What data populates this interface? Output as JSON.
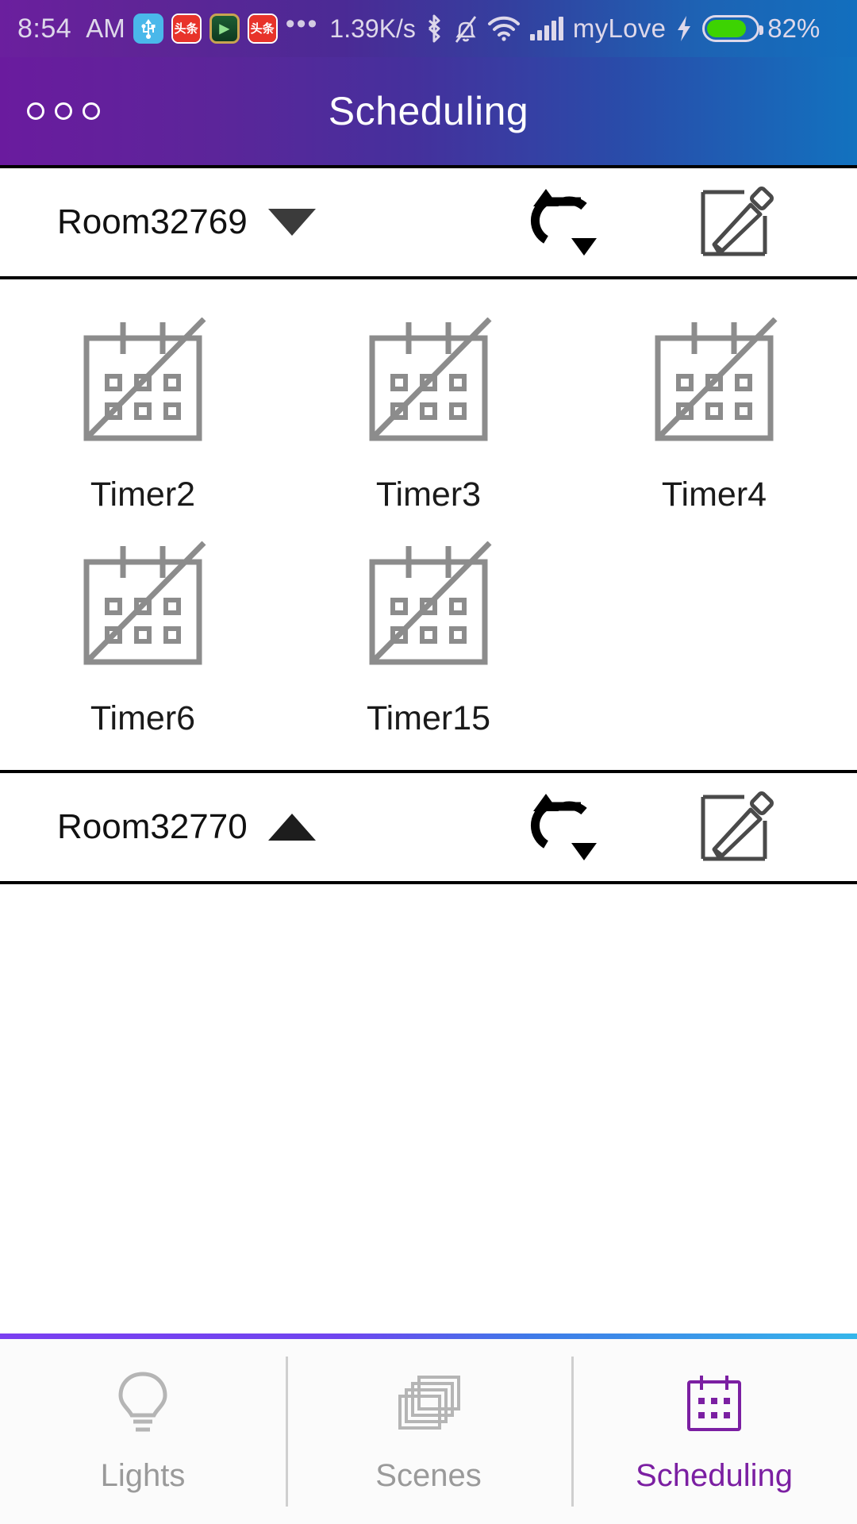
{
  "statusbar": {
    "time": "8:54",
    "ampm": "AM",
    "network_speed": "1.39K/s",
    "carrier": "myLove",
    "battery_percent": "82%",
    "battery_level": 82,
    "overflow_dots": "•••",
    "icons": [
      {
        "name": "usb-icon",
        "glyph": "Ψ"
      },
      {
        "name": "toutiao-app-icon",
        "glyph": "头条"
      },
      {
        "name": "media-player-app-icon",
        "glyph": "▶"
      },
      {
        "name": "toutiao-app-icon-2",
        "glyph": "头条"
      },
      {
        "name": "bluetooth-icon",
        "glyph": "bluetooth"
      },
      {
        "name": "silent-bell-icon",
        "glyph": "bell-muted"
      },
      {
        "name": "wifi-icon",
        "glyph": "wifi"
      },
      {
        "name": "cellular-signal-icon",
        "glyph": "signal"
      },
      {
        "name": "charging-bolt-icon",
        "glyph": "⚡"
      }
    ]
  },
  "appbar": {
    "title": "Scheduling",
    "menu_label": "menu"
  },
  "rooms": [
    {
      "name": "Room32769",
      "expanded": true,
      "caret": "down",
      "sync_label": "sync",
      "edit_label": "edit",
      "timers": [
        {
          "label": "Timer2"
        },
        {
          "label": "Timer3"
        },
        {
          "label": "Timer4"
        },
        {
          "label": "Timer6"
        },
        {
          "label": "Timer15"
        }
      ]
    },
    {
      "name": "Room32770",
      "expanded": false,
      "caret": "up",
      "sync_label": "sync",
      "edit_label": "edit",
      "timers": []
    }
  ],
  "bottomnav": {
    "tabs": [
      {
        "label": "Lights",
        "icon": "lightbulb-icon",
        "active": false
      },
      {
        "label": "Scenes",
        "icon": "layers-icon",
        "active": false
      },
      {
        "label": "Scheduling",
        "icon": "calendar-icon",
        "active": true
      }
    ],
    "accent_start": "#7a3ff0",
    "accent_end": "#35b6ea",
    "active_color": "#7b1fa2",
    "inactive_color": "#9a9a9a"
  },
  "colors": {
    "header_gradient_start": "#6a1b9e",
    "header_gradient_end": "#1272bf",
    "icon_gray": "#8c8c8c",
    "text_dark": "#1a1a1a"
  }
}
